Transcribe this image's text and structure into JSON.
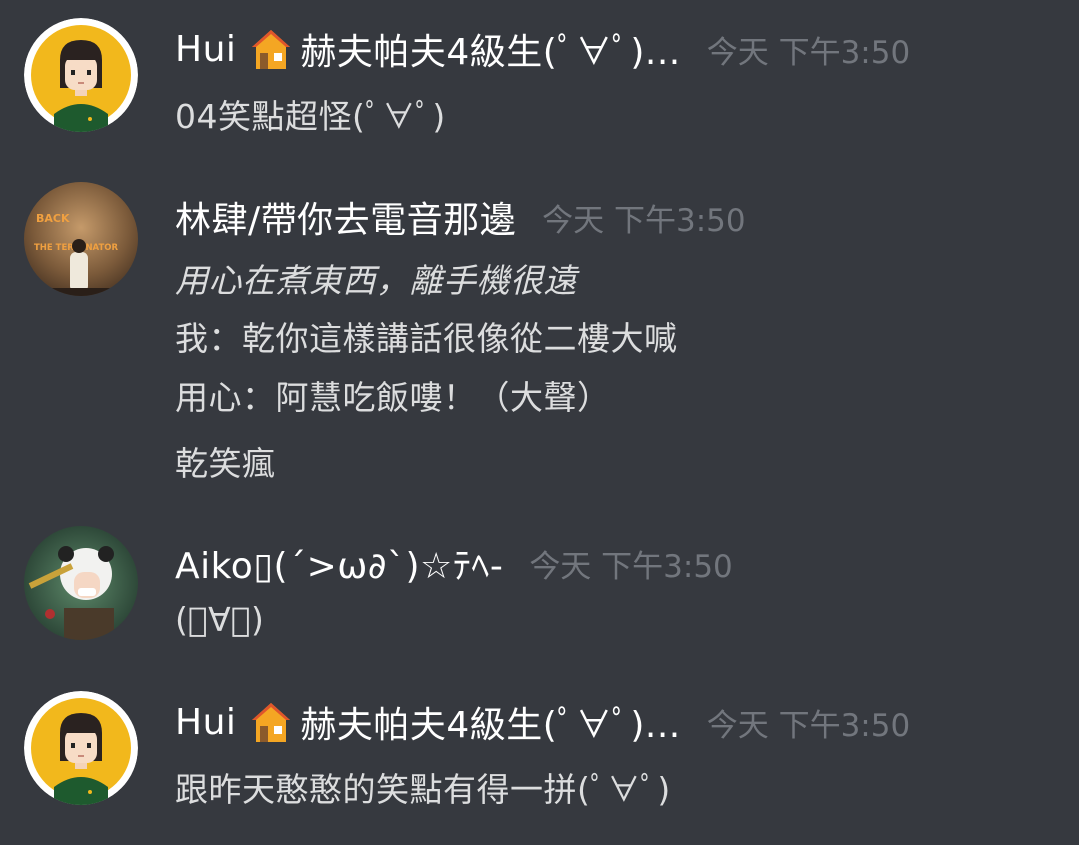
{
  "messages": [
    {
      "author": "Hui",
      "author_suffix": "赫夫帕夫4級生(ﾟ∀ﾟ)...",
      "badge_icon": "house-icon",
      "timestamp": "今天 下午3:50",
      "lines": [
        "04笑點超怪(ﾟ∀ﾟ)"
      ]
    },
    {
      "author": "林肆/帶你去電音那邊",
      "timestamp": "今天 下午3:50",
      "lines": [
        "用心在煮東西，離手機很遠",
        "我：乾你這樣講話很像從二樓大喊",
        "用心：阿慧吃飯嘍！（大聲）",
        "乾笑瘋"
      ],
      "avatar_text": [
        "BACK",
        "THE TERMINATOR"
      ]
    },
    {
      "author": "Aiko▯(´>ω∂`)☆ﾃﾍ-",
      "timestamp": "今天 下午3:50",
      "lines": [
        "(ﾟ∀ﾟ)"
      ]
    },
    {
      "author": "Hui",
      "author_suffix": "赫夫帕夫4級生(ﾟ∀ﾟ)...",
      "badge_icon": "house-icon",
      "timestamp": "今天 下午3:50",
      "lines": [
        "跟昨天憨憨的笑點有得一拼(ﾟ∀ﾟ)"
      ]
    }
  ],
  "colors": {
    "background": "#36393f",
    "username": "#ffffff",
    "text": "#dcddde",
    "timestamp": "#72767d"
  }
}
